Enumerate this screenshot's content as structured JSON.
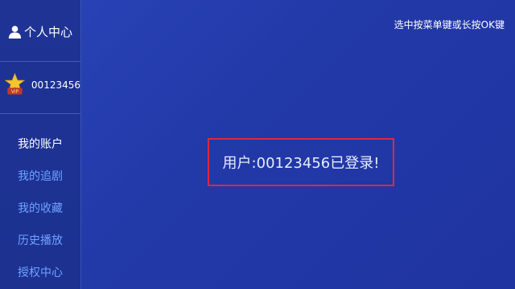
{
  "sidebar": {
    "title": "个人中心",
    "user_id": "00123456",
    "vip_badge_text": "VIP",
    "items": [
      {
        "label": "我的账户",
        "active": true
      },
      {
        "label": "我的追剧",
        "active": false
      },
      {
        "label": "我的收藏",
        "active": false
      },
      {
        "label": "历史播放",
        "active": false
      },
      {
        "label": "授权中心",
        "active": false
      }
    ]
  },
  "header": {
    "hint": "选中按菜单键或长按OK键"
  },
  "main": {
    "status": "用户:00123456已登录!"
  },
  "colors": {
    "background": "#2239a8",
    "sidebar": "#1e3394",
    "menu_inactive": "#6fa3ff",
    "menu_active": "#ffffff",
    "highlight_border": "#e0283a",
    "vip_star": "#f5c531",
    "vip_ribbon": "#c0392b"
  },
  "icons": {
    "profile": "person-icon",
    "vip": "vip-star-icon"
  }
}
